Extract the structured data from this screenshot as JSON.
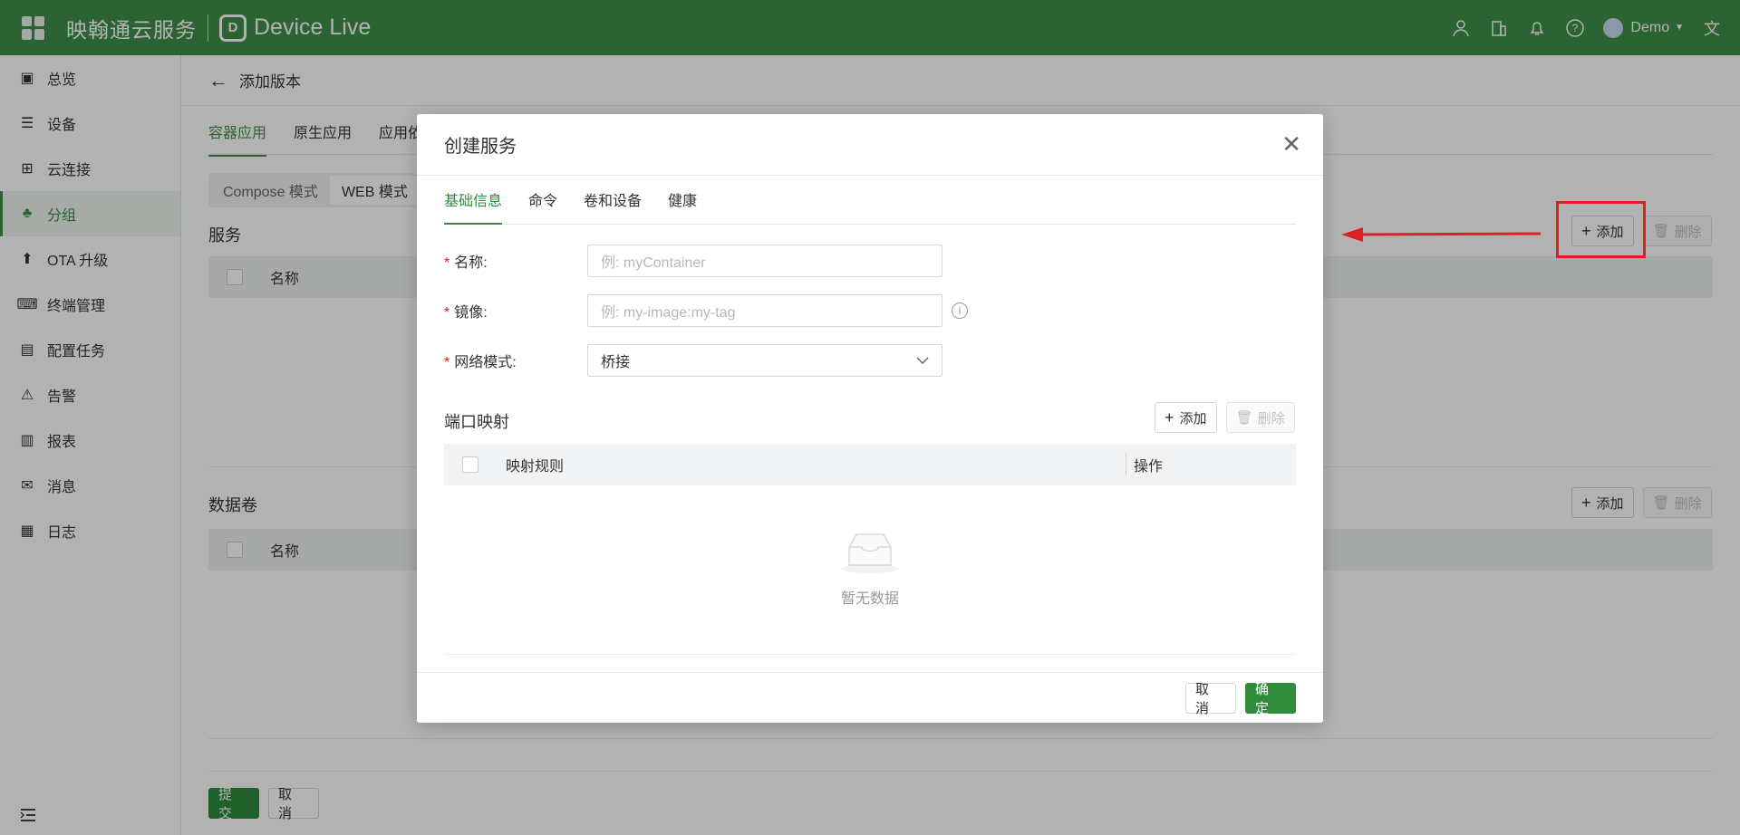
{
  "topbar": {
    "brand": "映翰通云服务",
    "product": "Device Live",
    "user": "Demo"
  },
  "sidebar": {
    "items": [
      {
        "label": "总览",
        "icon": "monitor-chart-icon"
      },
      {
        "label": "设备",
        "icon": "server-icon"
      },
      {
        "label": "云连接",
        "icon": "link-nodes-icon"
      },
      {
        "label": "分组",
        "icon": "group-icon"
      },
      {
        "label": "OTA 升级",
        "icon": "upload-arrow-icon"
      },
      {
        "label": "终端管理",
        "icon": "keyboard-icon"
      },
      {
        "label": "配置任务",
        "icon": "config-monitor-icon"
      },
      {
        "label": "告警",
        "icon": "alarm-icon"
      },
      {
        "label": "报表",
        "icon": "report-icon"
      },
      {
        "label": "消息",
        "icon": "message-icon"
      },
      {
        "label": "日志",
        "icon": "log-icon"
      }
    ]
  },
  "page": {
    "title": "添加版本",
    "tabs": [
      "容器应用",
      "原生应用",
      "应用依"
    ],
    "modes": [
      "Compose 模式",
      "WEB 模式"
    ],
    "services_title": "服务",
    "volumes_title": "数据卷",
    "add_label": "添加",
    "delete_label": "删除",
    "name_col": "名称",
    "submit_label": "提 交",
    "cancel_label": "取 消"
  },
  "modal": {
    "title": "创建服务",
    "tabs": [
      "基础信息",
      "命令",
      "卷和设备",
      "健康"
    ],
    "fields": {
      "name_label": "名称:",
      "name_placeholder": "例: myContainer",
      "image_label": "镜像:",
      "image_placeholder": "例: my-image:my-tag",
      "network_label": "网络模式:",
      "network_value": "桥接"
    },
    "ports_title": "端口映射",
    "add_label": "添加",
    "delete_label": "删除",
    "col_rule": "映射规则",
    "col_action": "操作",
    "empty_text": "暂无数据",
    "cancel_label": "取 消",
    "ok_label": "确 定"
  },
  "colors": {
    "brand_green": "#3f8e4a",
    "primary_green": "#2f8c3b",
    "annotation_red": "#e02020"
  }
}
